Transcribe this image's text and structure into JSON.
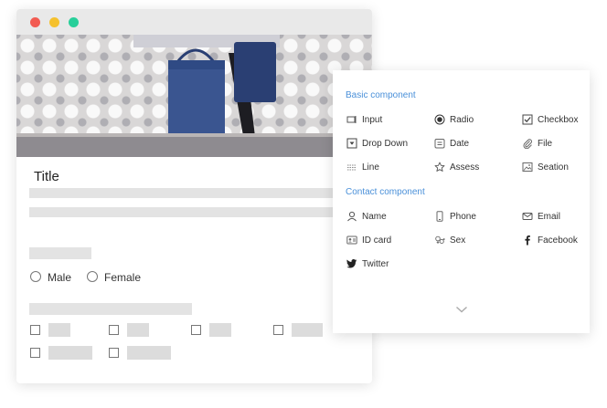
{
  "form": {
    "title": "Title",
    "radio_options": [
      "Male",
      "Female"
    ]
  },
  "panel": {
    "basic_title": "Basic component",
    "basic_items": [
      "Input",
      "Radio",
      "Checkbox",
      "Drop Down",
      "Date",
      "File",
      "Line",
      "Assess",
      "Seation"
    ],
    "contact_title": "Contact component",
    "contact_items": [
      "Name",
      "Phone",
      "Email",
      "ID card",
      "Sex",
      "Facebook",
      "Twitter"
    ]
  },
  "colors": {
    "accent": "#4a90d9",
    "window_close": "#f25b52",
    "window_minimize": "#f5c12e",
    "window_zoom": "#28cf9a"
  },
  "icons": {
    "basic": [
      "input-icon",
      "radio-selected-icon",
      "checkbox-checked-icon",
      "dropdown-icon",
      "date-icon",
      "paperclip-icon",
      "line-icon",
      "star-icon",
      "image-icon"
    ],
    "contact": [
      "person-icon",
      "phone-icon",
      "envelope-icon",
      "id-card-icon",
      "sex-icon",
      "facebook-icon",
      "twitter-icon"
    ],
    "expand": "chevron-down-icon"
  }
}
